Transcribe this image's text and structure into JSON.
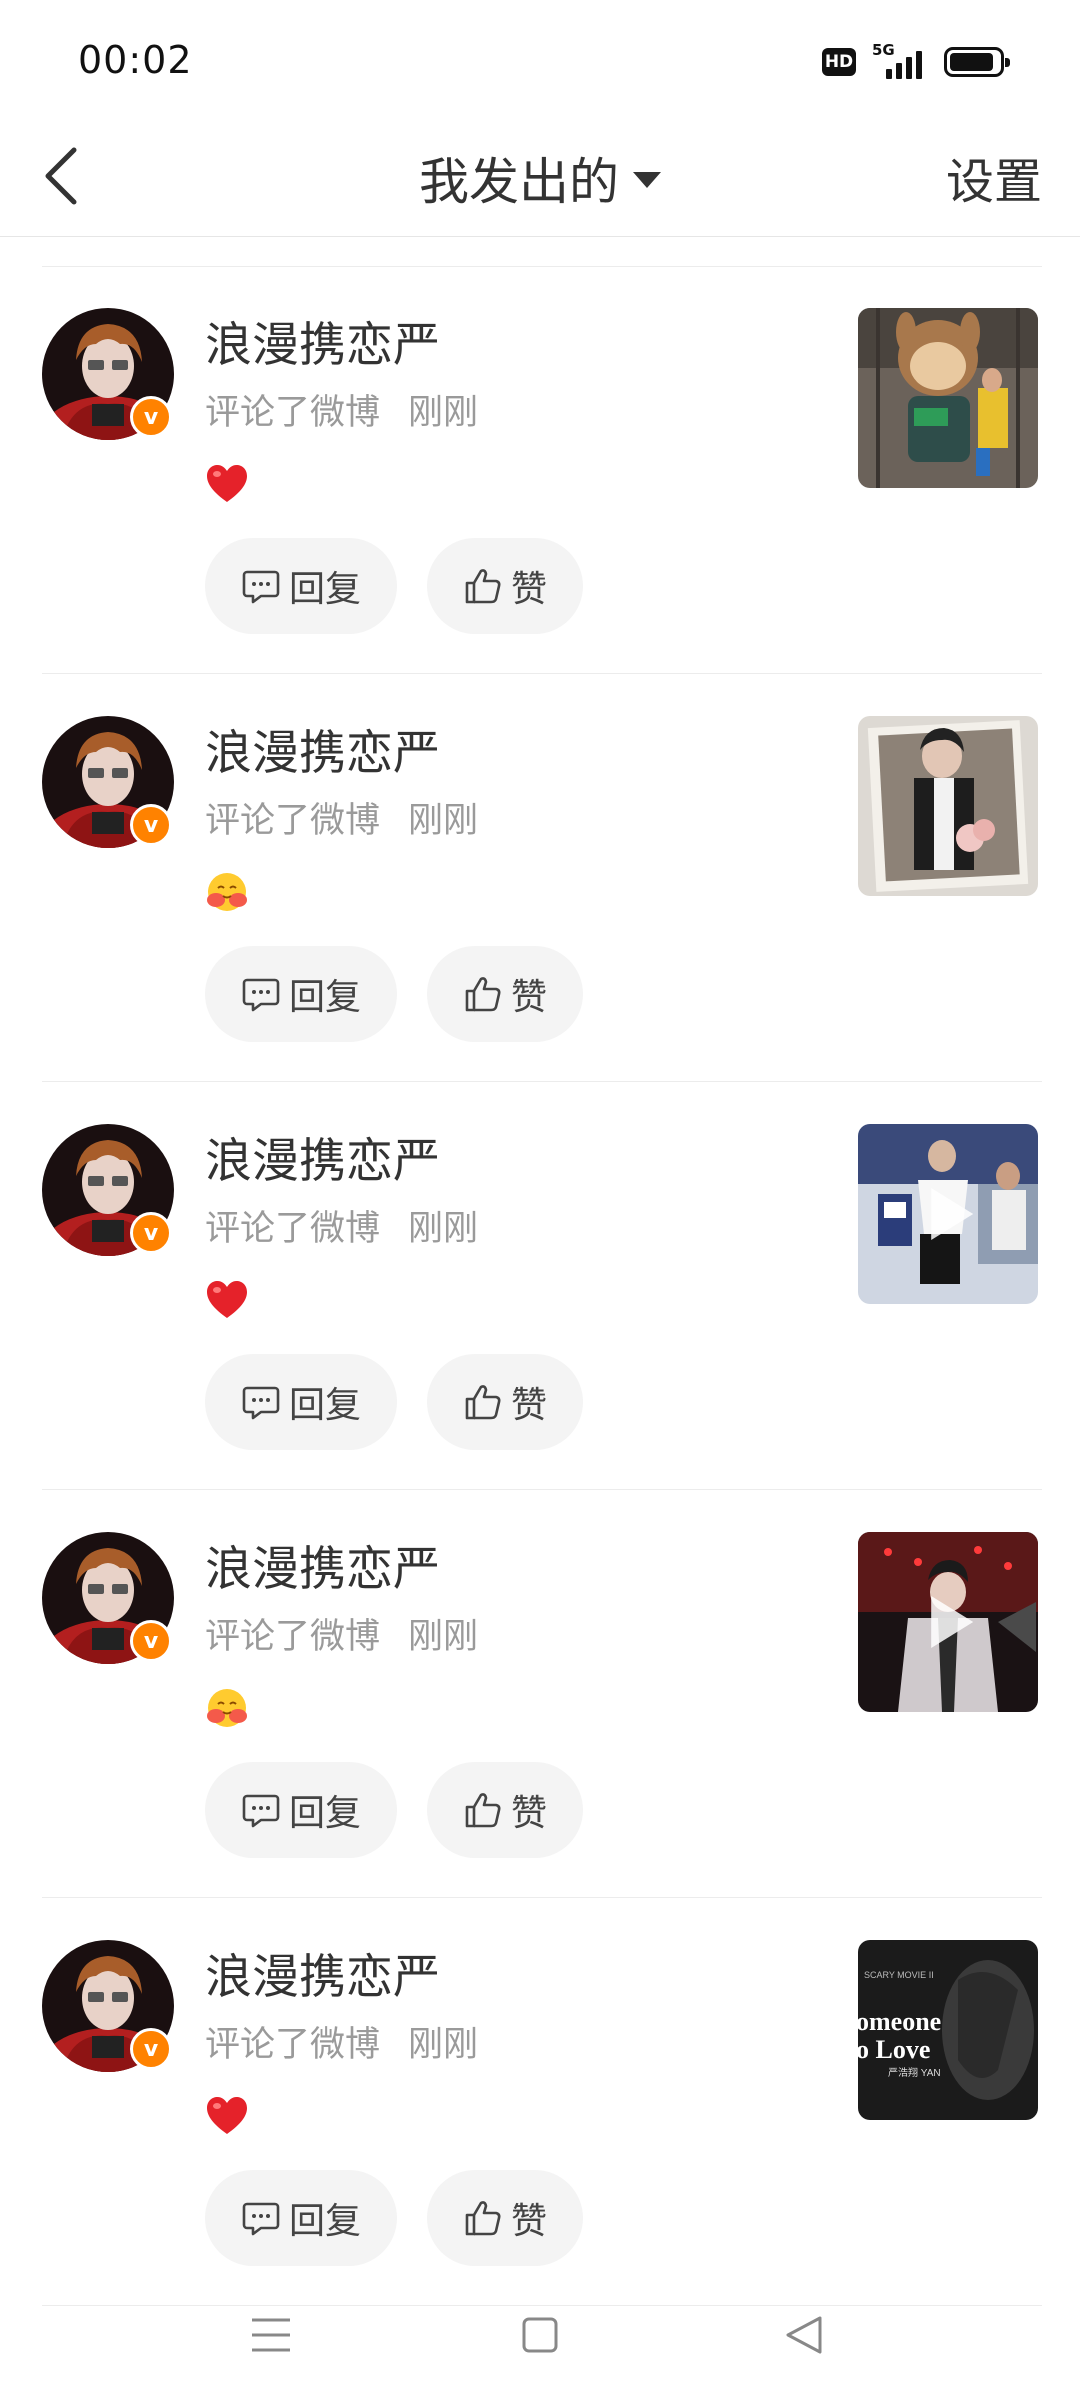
{
  "status": {
    "time": "00:02",
    "hd": "HD",
    "network": "5G",
    "battery_level": 0.9
  },
  "header": {
    "title": "我发出的",
    "settings_label": "设置"
  },
  "items": [
    {
      "username": "浪漫携恋严",
      "action": "评论了微博",
      "time": "刚刚",
      "emoji": "heart-emoji",
      "thumb": "toy-photo",
      "has_video": false
    },
    {
      "username": "浪漫携恋严",
      "action": "评论了微博",
      "time": "刚刚",
      "emoji": "hug-emoji",
      "thumb": "portrait-photo",
      "has_video": false
    },
    {
      "username": "浪漫携恋严",
      "action": "评论了微博",
      "time": "刚刚",
      "emoji": "heart-emoji",
      "thumb": "station-video",
      "has_video": true
    },
    {
      "username": "浪漫携恋严",
      "action": "评论了微博",
      "time": "刚刚",
      "emoji": "hug-emoji",
      "thumb": "stage-video",
      "has_video": true
    },
    {
      "username": "浪漫携恋严",
      "action": "评论了微博",
      "time": "刚刚",
      "emoji": "heart-emoji",
      "thumb": "poster-image",
      "has_video": false
    }
  ],
  "labels": {
    "reply": "回复",
    "like": "赞"
  },
  "colors": {
    "verified": "#ff8200",
    "heart": "#e5222a",
    "button_bg": "#f4f4f4"
  },
  "poster_text": {
    "line1": "omeone",
    "line2": "o  Love",
    "small": "SCARY MOVIE II",
    "credit": "严浩翔 YAN"
  }
}
